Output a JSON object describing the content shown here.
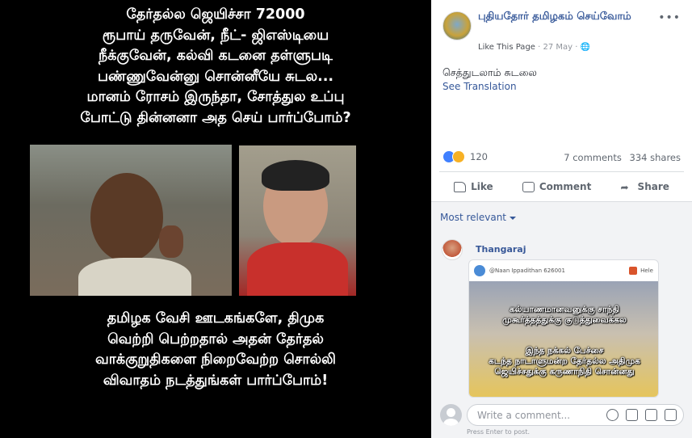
{
  "meme": {
    "top_lines": [
      "தேர்தல்ல ஜெயிச்சா 72000",
      "ரூபாய் தருவேன், நீட்- ஜிஎஸ்டியை",
      "நீக்குவேன், கல்வி கடனை தள்ளுபடி",
      "பண்ணுவேன்னு சொன்னீயே சுடல...",
      "மானம் ரோசம் இருந்தா, சோத்துல உப்பு",
      "போட்டு தின்னனா அத செய் பார்ப்போம்?"
    ],
    "bottom_lines": [
      "தமிழக வேசி ஊடகங்களே, திமுக",
      "வெற்றி பெற்றதால் அதன் தேர்தல்",
      "வாக்குறுதிகளை நிறைவேற்ற சொல்லி",
      "விவாதம் நடத்துங்கள் பார்ப்போம்!"
    ]
  },
  "post": {
    "page_name": "புதியதோர் தமிழகம் செய்வோம்",
    "like_page": "Like This Page",
    "date": "27 May",
    "separator": "·",
    "text": "செத்துடலாம் சுடலை",
    "see_translation": "See Translation",
    "reaction_count": "120",
    "comments_count": "7 comments",
    "shares_count": "334 shares",
    "more_label": "•••"
  },
  "actions": {
    "like": "Like",
    "comment": "Comment",
    "share": "Share"
  },
  "comments": {
    "sort_label": "Most relevant",
    "items": [
      {
        "author": "Thangaraj",
        "image_header_handle": "@Naan Ippadithan 626001",
        "image_header_label": "Hele",
        "caption_top": [
          "கல்யாணமானவனுக்கு சாந்தி",
          "முகூர்த்தத்துக்கு குடுத்துவைக்கல"
        ],
        "caption_bottom": [
          "இந்த நக்கல் பேச்சை",
          "கடந்த நாடாளுமன்ற தேர்தல்ல அதிமுக",
          "ஜெயிச்சதுக்கு கருணாநிதி சொன்னது"
        ]
      }
    ]
  },
  "compose": {
    "placeholder": "Write a comment...",
    "hint": "Press Enter to post."
  },
  "colors": {
    "link": "#365899",
    "panel_bg": "#f2f3f5",
    "like_blue": "#4080ff",
    "haha_yellow": "#f7b125"
  }
}
